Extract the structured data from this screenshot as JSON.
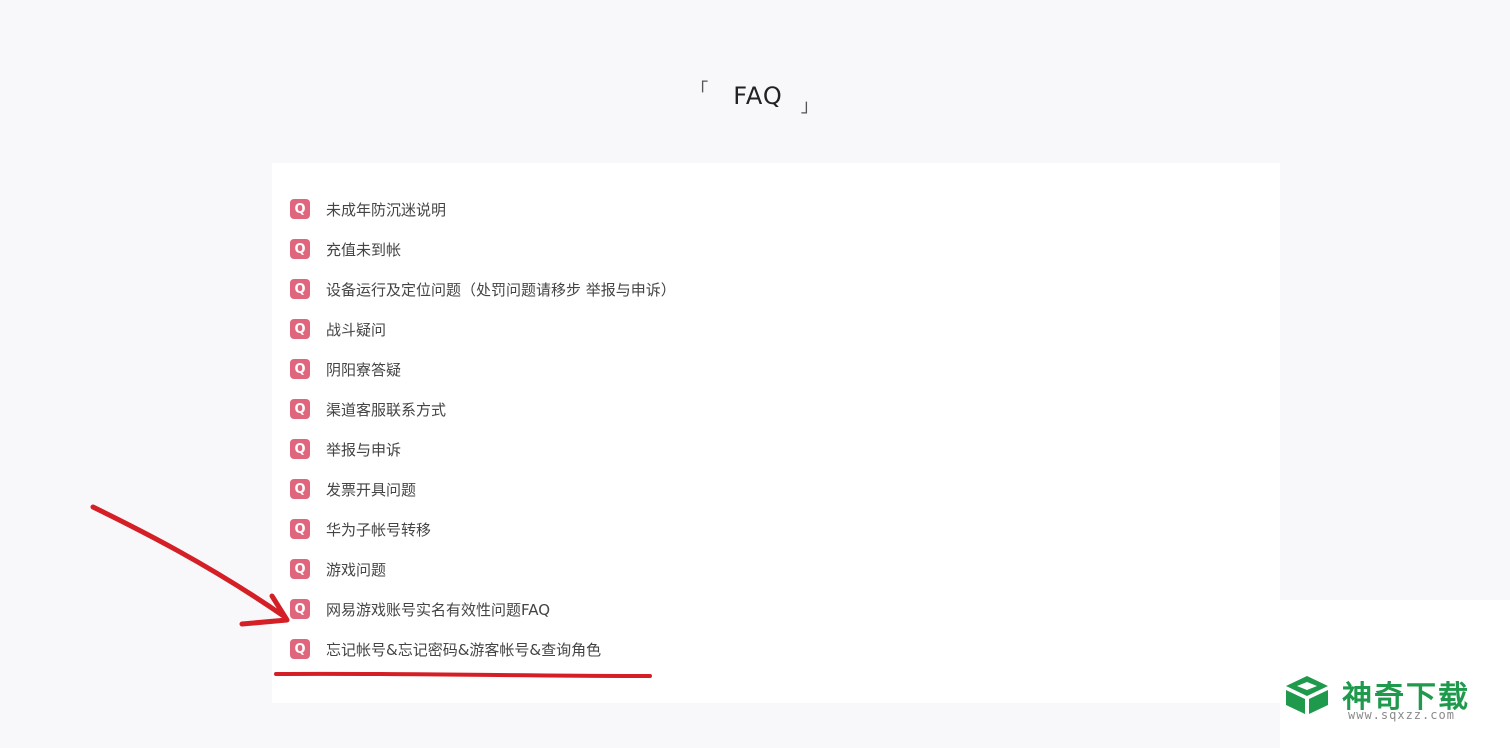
{
  "faq": {
    "title": "FAQ",
    "bracket_open": "「",
    "bracket_close": "」",
    "badge": "Q",
    "items": [
      "未成年防沉迷说明",
      "充值未到帐",
      "设备运行及定位问题（处罚问题请移步 举报与申诉）",
      "战斗疑问",
      "阴阳寮答疑",
      "渠道客服联系方式",
      "举报与申诉",
      "发票开具问题",
      "华为子帐号转移",
      "游戏问题",
      "网易游戏账号实名有效性问题FAQ",
      "忘记帐号&忘记密码&游客帐号&查询角色"
    ]
  },
  "watermark": {
    "name": "神奇下载",
    "url": "www.sqxzz.com",
    "color": "#1f9a4c"
  },
  "colors": {
    "badge": "#e0667e",
    "annotation": "#d41f26"
  }
}
